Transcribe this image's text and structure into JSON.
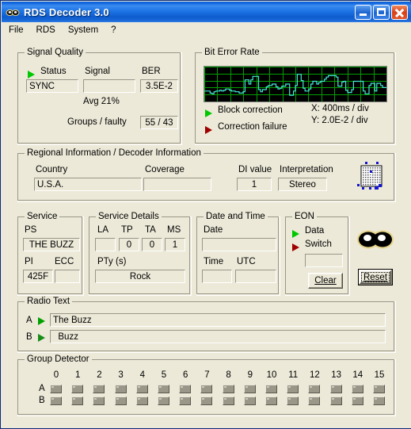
{
  "window": {
    "title": "RDS Decoder 3.0",
    "icon": "glasses-icon",
    "buttons": {
      "minimize": "minimize",
      "maximize": "maximize",
      "close": "close"
    }
  },
  "menu": {
    "items": [
      "File",
      "RDS",
      "System",
      "?"
    ]
  },
  "signal_quality": {
    "legend": "Signal Quality",
    "status_label": "Status",
    "status_value": "SYNC",
    "signal_label": "Signal",
    "signal_value": "",
    "ber_label": "BER",
    "ber_value": "3.5E-2",
    "avg_label": "Avg  21%",
    "groups_label": "Groups / faulty",
    "groups_value": "55 / 43"
  },
  "bit_error_rate": {
    "legend": "Bit Error Rate",
    "block_correction": "Block correction",
    "correction_failure": "Correction failure",
    "x_scale": "X: 400ms / div",
    "y_scale": "Y: 2.0E-2 / div"
  },
  "chart_data": {
    "type": "line",
    "title": "Bit Error Rate",
    "xlabel": "X: 400ms / div",
    "ylabel": "Y: 2.0E-2 / div",
    "x_per_div_ms": 400,
    "y_per_div": 0.02,
    "grid": true,
    "grid_cols": 14,
    "grid_rows": 5,
    "line_color": "#45e8d8",
    "grid_color": "#00a000",
    "bg_color": "#000000",
    "ylim": [
      0,
      0.1
    ],
    "values": [
      0.03,
      0.03,
      0.03,
      0.024,
      0.022,
      0.028,
      0.03,
      0.03,
      0.032,
      0.03,
      0.032,
      0.036,
      0.036,
      0.032,
      0.03,
      0.03,
      0.028,
      0.028,
      0.024,
      0.024,
      0.028,
      0.062,
      0.062,
      0.05,
      0.062,
      0.072,
      0.072,
      0.072,
      0.034,
      0.028,
      0.034,
      0.034,
      0.042,
      0.046,
      0.046,
      0.05,
      0.05,
      0.042,
      0.036,
      0.038,
      0.044,
      0.044,
      0.05,
      0.05,
      0.018,
      0.018,
      0.03,
      0.046,
      0.078,
      0.078,
      0.06,
      0.038,
      0.03,
      0.03,
      0.036,
      0.05,
      0.058,
      0.058,
      0.05,
      0.054,
      0.058,
      0.058,
      0.064,
      0.07,
      0.074,
      0.074,
      0.074,
      0.074,
      0.07,
      0.044,
      0.044,
      0.056,
      0.058,
      0.032,
      0.026,
      0.026,
      0.034,
      0.058,
      0.058,
      0.058,
      0.058,
      0.058,
      0.03,
      0.022,
      0.022,
      0.046,
      0.052,
      0.052,
      0.03,
      0.052,
      0.052,
      0.046,
      0.04,
      0.04
    ]
  },
  "regional": {
    "legend": "Regional Information / Decoder Information",
    "country_label": "Country",
    "country_value": "U.S.A.",
    "coverage_label": "Coverage",
    "coverage_value": "",
    "di_label": "DI value",
    "di_value": "1",
    "interpretation_label": "Interpretation",
    "interpretation_value": "Stereo",
    "icon": "dot-matrix-icon"
  },
  "service": {
    "legend": "Service",
    "ps_label": "PS",
    "ps_value": "THE BUZZ",
    "pi_label": "PI",
    "pi_value": "425F",
    "ecc_label": "ECC",
    "ecc_value": ""
  },
  "service_details": {
    "legend": "Service Details",
    "la_label": "LA",
    "la_value": "",
    "tp_label": "TP",
    "tp_value": "0",
    "ta_label": "TA",
    "ta_value": "0",
    "ms_label": "MS",
    "ms_value": "1",
    "pty_label": "PTy (s)",
    "pty_value": "Rock"
  },
  "date_time": {
    "legend": "Date and Time",
    "date_label": "Date",
    "date_value": "",
    "time_label": "Time",
    "time_value": "",
    "utc_label": "UTC",
    "utc_value": ""
  },
  "eon": {
    "legend": "EON",
    "data_label": "Data",
    "switch_label": "Switch",
    "value": "",
    "clear_button": "Clear",
    "clear_accel": "C"
  },
  "reset": {
    "button_label": "Reset",
    "accel": "R",
    "icon": "glasses-icon"
  },
  "radio_text": {
    "legend": "Radio Text",
    "a_label": "A",
    "a_value": "The Buzz",
    "b_label": "B",
    "b_value": "  Buzz"
  },
  "group_detector": {
    "legend": "Group Detector",
    "columns": [
      "0",
      "1",
      "2",
      "3",
      "4",
      "5",
      "6",
      "7",
      "8",
      "9",
      "10",
      "11",
      "12",
      "13",
      "14",
      "15"
    ],
    "row_a_label": "A",
    "row_b_label": "B",
    "row_a_states": [
      0,
      0,
      0,
      0,
      0,
      0,
      0,
      0,
      0,
      0,
      0,
      0,
      0,
      0,
      0,
      0
    ],
    "row_b_states": [
      0,
      0,
      0,
      0,
      0,
      0,
      0,
      0,
      0,
      0,
      0,
      0,
      0,
      0,
      0,
      0
    ]
  },
  "colors": {
    "titlebar": "#1568e0",
    "face": "#ece9d8",
    "led_green": "#00c800",
    "led_red": "#a00000",
    "scope_bg": "#000000",
    "scope_grid": "#00a000",
    "scope_trace": "#45e8d8"
  }
}
